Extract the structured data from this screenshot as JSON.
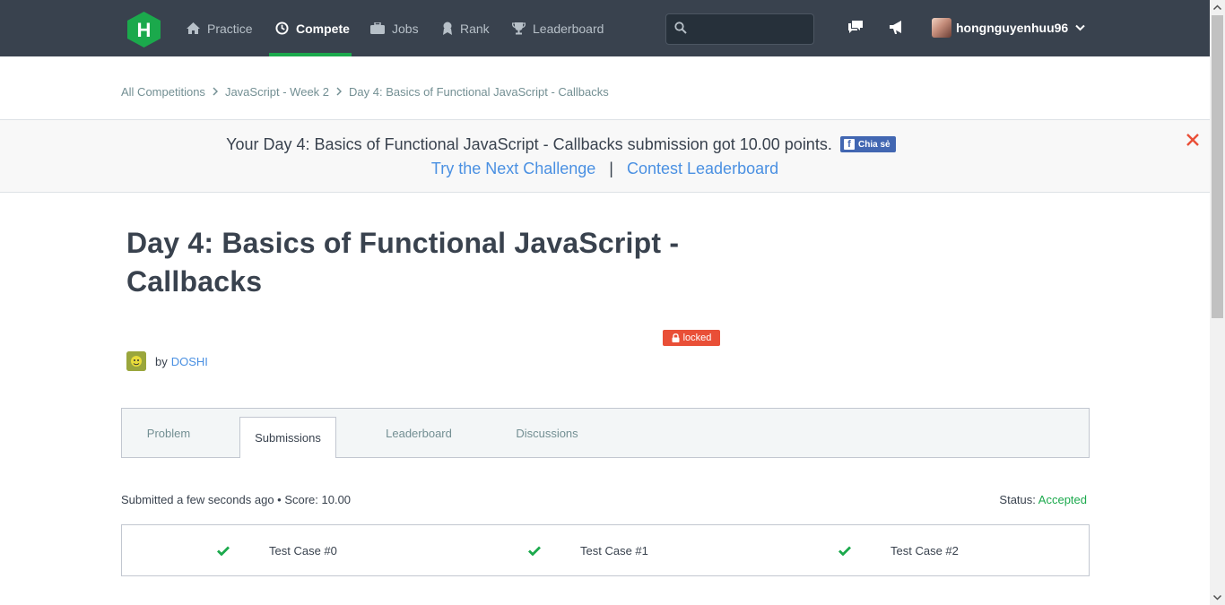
{
  "nav": {
    "items": [
      {
        "label": "Practice",
        "icon": "home-icon"
      },
      {
        "label": "Compete",
        "icon": "clock-icon"
      },
      {
        "label": "Jobs",
        "icon": "briefcase-icon"
      },
      {
        "label": "Rank",
        "icon": "rank-medal-icon"
      },
      {
        "label": "Leaderboard",
        "icon": "trophy-icon"
      }
    ],
    "active": "Compete",
    "search": {
      "value": "",
      "placeholder": ""
    },
    "username": "hongnguyenhuu96"
  },
  "breadcrumb": [
    "All Competitions",
    "JavaScript - Week 2",
    "Day 4: Basics of Functional JavaScript - Callbacks"
  ],
  "notification": {
    "message": "Your Day 4: Basics of Functional JavaScript - Callbacks submission got 10.00 points.",
    "share_label": "Chia sẻ",
    "next_link": "Try the Next Challenge",
    "separator": "|",
    "leaderboard_link": "Contest Leaderboard"
  },
  "challenge": {
    "title": "Day 4: Basics of Functional JavaScript - Callbacks",
    "badge": "locked",
    "by_label": "by",
    "author": "DOSHI"
  },
  "tabs": [
    {
      "label": "Problem"
    },
    {
      "label": "Submissions"
    },
    {
      "label": "Leaderboard"
    },
    {
      "label": "Discussions"
    }
  ],
  "active_tab": "Submissions",
  "submission": {
    "summary": "Submitted a few seconds ago • Score: 10.00",
    "status_label": "Status:",
    "status_value": "Accepted",
    "test_cases": [
      {
        "label": "Test Case #0",
        "passed": true
      },
      {
        "label": "Test Case #1",
        "passed": true
      },
      {
        "label": "Test Case #2",
        "passed": true
      }
    ]
  },
  "colors": {
    "nav_bg": "#39424e",
    "accent_green": "#1ba94c",
    "link_blue": "#4a90e2",
    "locked_red": "#e94f37",
    "close_red": "#e94f37"
  }
}
